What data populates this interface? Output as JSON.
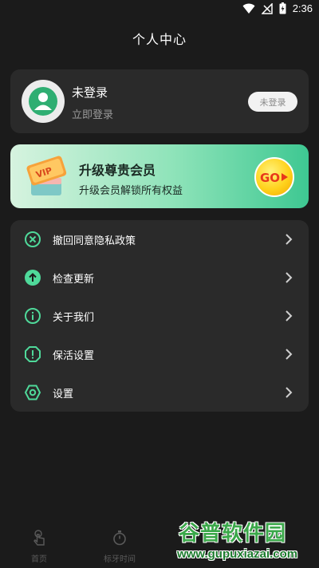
{
  "status_bar": {
    "time": "2:36",
    "icons": [
      "wifi-icon",
      "signal-off-icon",
      "battery-charging-icon"
    ]
  },
  "header": {
    "title": "个人中心"
  },
  "profile": {
    "name": "未登录",
    "login_link": "立即登录",
    "login_button": "未登录",
    "avatar_icon": "user-icon"
  },
  "vip": {
    "title": "升级尊贵会员",
    "subtitle": "升级会员解锁所有权益",
    "ticket_text": "VIP",
    "go_label": "GO",
    "accent_start": "#d6f3df",
    "accent_end": "#3ec892"
  },
  "menu": {
    "items": [
      {
        "label": "撤回同意隐私政策",
        "icon": "revoke-x-icon"
      },
      {
        "label": "检查更新",
        "icon": "update-arrow-icon"
      },
      {
        "label": "关于我们",
        "icon": "info-icon"
      },
      {
        "label": "保活设置",
        "icon": "keep-alive-icon"
      },
      {
        "label": "设置",
        "icon": "settings-icon"
      }
    ],
    "icon_color": "#4fd99a"
  },
  "bottom_nav": {
    "items": [
      {
        "label": "首页",
        "icon": "home-touch-icon"
      },
      {
        "label": "标牙时间",
        "icon": "timer-icon"
      }
    ]
  },
  "watermark": {
    "title": "谷普软件园",
    "url": "www.gupuxiazai.com"
  }
}
